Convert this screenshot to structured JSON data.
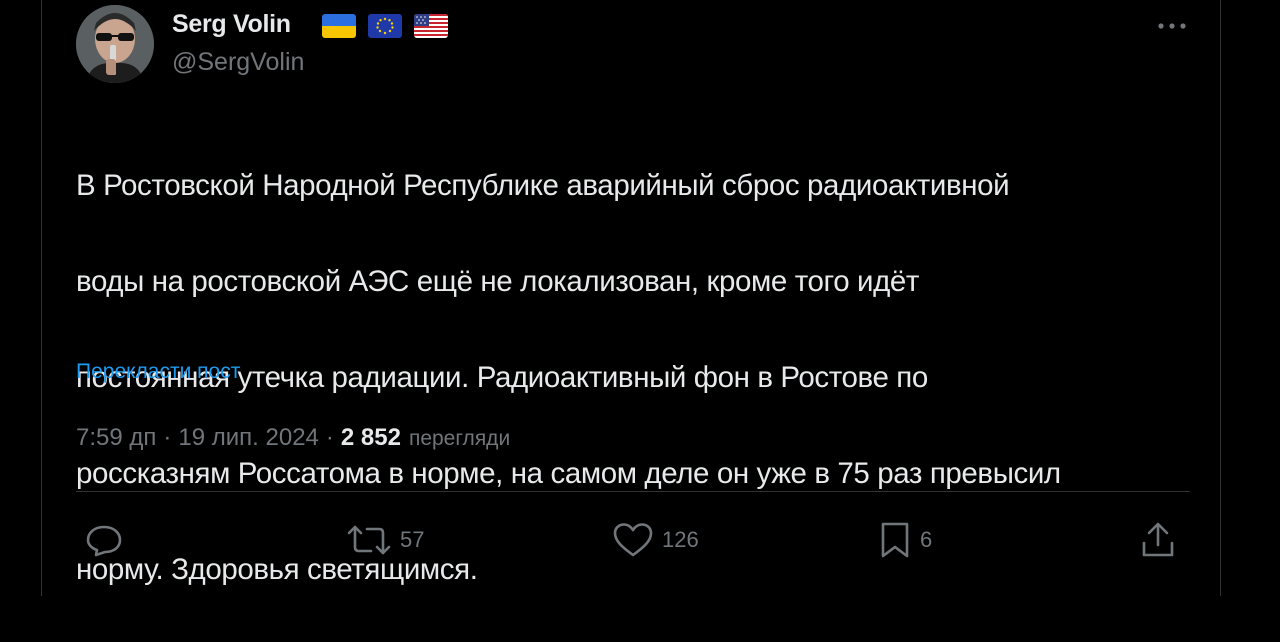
{
  "author": {
    "display_name": "Serg Volin",
    "handle": "@SergVolin",
    "flags": [
      "ukraine-flag",
      "eu-flag",
      "usa-flag"
    ]
  },
  "post": {
    "text_lines": [
      "В Ростовской Народной Республике аварийный сброс радиоактивной",
      "воды на ростовской АЭС ещё не локализован, кроме того идёт",
      "постоянная утечка радиации. Радиоактивный фон в Ростове по",
      "россказням Россатома в норме, на самом деле он уже в 75 раз превысил",
      "норму. Здоровья светящимся."
    ],
    "translate_link": "Перекласти пост"
  },
  "meta": {
    "time": "7:59 дп",
    "separator": "·",
    "date": "19 лип. 2024",
    "views_count": "2 852",
    "views_label": "перегляди"
  },
  "actions": {
    "reply": {
      "icon": "reply-icon",
      "count": ""
    },
    "repost": {
      "icon": "repost-icon",
      "count": "57"
    },
    "like": {
      "icon": "heart-icon",
      "count": "126"
    },
    "bookmark": {
      "icon": "bookmark-icon",
      "count": "6"
    },
    "share": {
      "icon": "share-icon",
      "count": ""
    }
  },
  "colors": {
    "background": "#000000",
    "text": "#e7e9ea",
    "muted": "#71767b",
    "link": "#1d9bf0",
    "border": "#2f3336"
  }
}
